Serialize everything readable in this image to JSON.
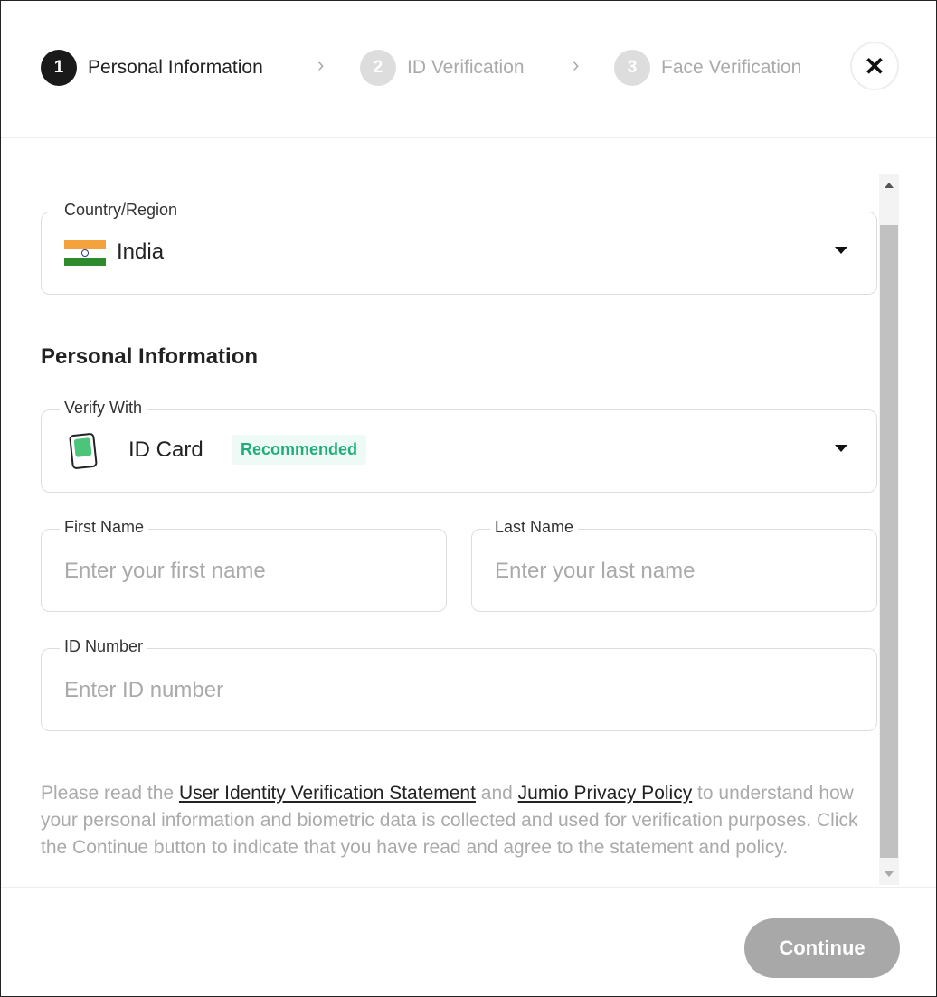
{
  "steps": [
    {
      "num": "1",
      "label": "Personal Information",
      "active": true
    },
    {
      "num": "2",
      "label": "ID Verification",
      "active": false
    },
    {
      "num": "3",
      "label": "Face Verification",
      "active": false
    }
  ],
  "country": {
    "label": "Country/Region",
    "value": "India"
  },
  "section_title": "Personal Information",
  "verify": {
    "label": "Verify With",
    "value": "ID Card",
    "badge": "Recommended",
    "badge_color": "#1fae7a"
  },
  "first_name": {
    "label": "First Name",
    "placeholder": "Enter your first name"
  },
  "last_name": {
    "label": "Last Name",
    "placeholder": "Enter your last name"
  },
  "id_number": {
    "label": "ID Number",
    "placeholder": "Enter ID number"
  },
  "note": {
    "pre": "Please read the ",
    "link1": "User Identity Verification Statement",
    "mid": " and ",
    "link2": "Jumio Privacy Policy",
    "post": " to understand how your personal information and biometric data is collected and used for verification purposes. Click the Continue button to indicate that you have read and agree to the statement and policy."
  },
  "continue_label": "Continue"
}
